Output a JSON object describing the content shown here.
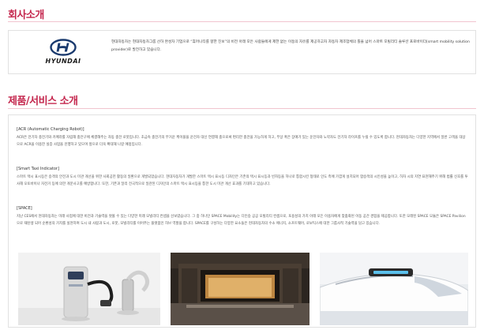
{
  "company": {
    "heading": "회사소개",
    "logo_text": "HYUNDAI",
    "description": "현대자동차는 현대자동차그룹 산하 완성차 기업으로 “휴머니티를 향한 진보”의 비전 아래 모든 사람들에게 제한 없는 이동의 자유를 제공하고자 자동차 제조업체의 틀을 넘어 스마트 모빌리티 솔루션 프로바이더(smart mobility solution provider)로 발전하고 있습니다."
  },
  "products": {
    "heading": "제품/서비스 소개",
    "items": [
      {
        "title": "[ACR (Automatic Charging Robot)]",
        "desc": "ACR은 전기차 충전기와 카메라를 자립해 충전구에 체결해주는 자동 충전 로봇입니다. 초급속 충전기의 무거운 케이블을 운전자 대신 연결해 충으로써 편리한 충전을 가능하게 하고, 무상 혹은 장애가 있는 운전자와 노약자도 전기차 라이프를 누릴 수 있도록 합니다. 현대자동차는 다양한 지역에서 일반 고객을 대상으로 ACR을 이용한 실증 사업을 진행하고 있으며 앞으로 더욱 확대해 나갈 예정입니다."
      },
      {
        "title": "[Smart Taxi Indicator]",
        "desc": "스마트 택시 표시등은 승객의 안전과 도시 미관 개선을 위한 사회공헌 활동의 일환으로 개발되었습니다. 현대자동차가 개발한 스마트 택시 표시등 디자인은 기존의 택시 표시등과 빈차등을 하나로 통합시킨 형태로 인도 측에 가깝게 설치되어 합승객의 시인성을 높이고, 하차 시의 지연 표현해주기 위해 법률 신호를 투사해 오토바이나 자전거 등에 의한 개문사고를 예방합니다. 또한, 기존과 달리 전국적으로 일관된 디자인의 스마트 택시 표시등을 통한 도시 미관 개선 효과를 기대하고 있습니다."
      },
      {
        "title": "[SPACE]",
        "desc": "지난 CES에서 현대자동차는 미래 사업에 대한 비전과 기술력을 엿볼 수 있는 다양한 미래 모빌리티 컨셉을 선보였습니다. 그 중 하나인 SPACE Mobility는 다인승 공공 모빌리티 컨셉으로, 포용성의 가치 아래 모든 이용자에게 맞춤화된 이동 공간 경험을 제공합니다. 또한 모래된 SPACE 모듈은 SPACE Pavilion으로 재탄생 되어 순환성의 가치를 실현하며 도시 내 사람과 도시, 로봇, 모빌리티를 이어주는 플랫폼인 허브 역할을 합니다. SPACE를 구성하는 다양한 요소들은 현대자동차의 수소 에너지, 소프트웨어, 로보틱스에 대한 그룹사적 기술력을 담고 있습니다."
      }
    ]
  },
  "colors": {
    "accent": "#c4264d",
    "border": "#e1e1e1"
  }
}
